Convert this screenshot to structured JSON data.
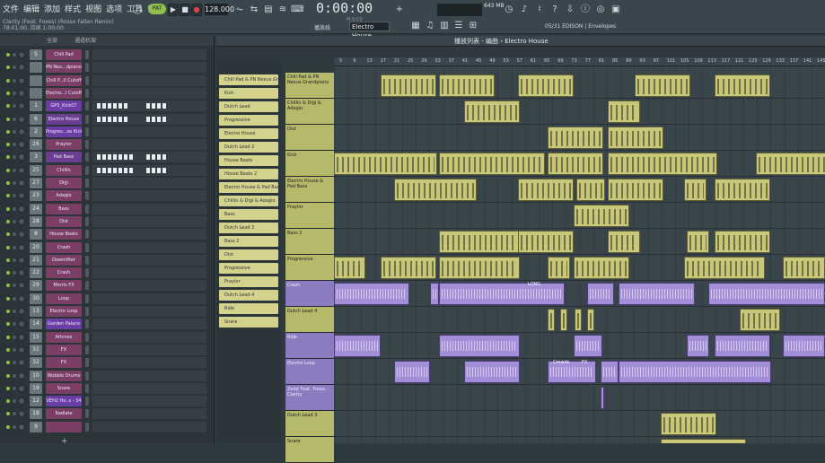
{
  "menu": [
    "文件",
    "编辑",
    "添加",
    "样式",
    "视图",
    "选项",
    "工具",
    "帮助"
  ],
  "song": {
    "title": "Clarity (Feat. Foxes) (Rosso Fallen Remix)",
    "info": "78:01:00, 持续 1:00:00"
  },
  "transport": {
    "pat": "PAT",
    "tempo": "128.000",
    "time": "0:00:00",
    "time_sub": "M:S:CS",
    "playback": "播放线",
    "pattern": "Electro House"
  },
  "memory": "643 MB",
  "hint": "05/31  EDISON | Envelopes",
  "rack": {
    "header": "全部",
    "title": "通道机架",
    "footer": "+",
    "channels": [
      {
        "num": "5",
        "name": "Chill Pad",
        "color": "#7b3e64"
      },
      {
        "num": "",
        "name": "PN Nex...dpiano",
        "color": "#7b3e64"
      },
      {
        "num": "",
        "name": "Chill P...il Cutoff",
        "color": "#7b3e64"
      },
      {
        "num": "",
        "name": "Electro...l Cutoff",
        "color": "#7b3e64"
      },
      {
        "num": "1",
        "name": "GPS_Kick07",
        "color": "#6a3ea4"
      },
      {
        "num": "6",
        "name": "Electro House",
        "color": "#6a3e90"
      },
      {
        "num": "2",
        "name": "Progres...se Kick",
        "color": "#6a3ea4"
      },
      {
        "num": "26",
        "name": "Praylor",
        "color": "#7b3e64"
      },
      {
        "num": "3",
        "name": "Pad Bass",
        "color": "#6a3e90"
      },
      {
        "num": "25",
        "name": "Chillin",
        "color": "#7b3e64"
      },
      {
        "num": "27",
        "name": "Digi",
        "color": "#7b3e64"
      },
      {
        "num": "23",
        "name": "Adagio",
        "color": "#7b3e64"
      },
      {
        "num": "24",
        "name": "Bass",
        "color": "#7b3e64"
      },
      {
        "num": "28",
        "name": "Dist",
        "color": "#7b3e64"
      },
      {
        "num": "8",
        "name": "House Beats",
        "color": "#7b3e64"
      },
      {
        "num": "20",
        "name": "Crash",
        "color": "#7b3e64"
      },
      {
        "num": "21",
        "name": "Downlifter",
        "color": "#7b3e64"
      },
      {
        "num": "22",
        "name": "Crash",
        "color": "#7b3e64"
      },
      {
        "num": "29",
        "name": "Morris FX",
        "color": "#7b3e64"
      },
      {
        "num": "30",
        "name": "Loop",
        "color": "#7b3e64"
      },
      {
        "num": "13",
        "name": "Electro Loop",
        "color": "#7b3e64"
      },
      {
        "num": "14",
        "name": "Garden Palace",
        "color": "#6a3ea4"
      },
      {
        "num": "15",
        "name": "Athmos",
        "color": "#7b3e64"
      },
      {
        "num": "31",
        "name": "FX",
        "color": "#7b3e64"
      },
      {
        "num": "32",
        "name": "FX",
        "color": "#7b3e64"
      },
      {
        "num": "10",
        "name": "Wobble Drums",
        "color": "#7b3e64"
      },
      {
        "num": "19",
        "name": "Snare",
        "color": "#7b3e64"
      },
      {
        "num": "12",
        "name": "VEH2 Ho..s - 34",
        "color": "#6a3ea4"
      },
      {
        "num": "18",
        "name": "Radiate",
        "color": "#7b3e64"
      },
      {
        "num": "9",
        "name": "",
        "color": "#7b3e64"
      }
    ]
  },
  "picker": [
    "Chill Pad & PN Nexus Grandpiano",
    "Kick",
    "Dutch Lead",
    "Progressive",
    "Electro House",
    "Dutch Lead 2",
    "House Beats",
    "House Beats 2",
    "Electro House & Pad Bass",
    "Chillin & Digi & Adagio",
    "Bass",
    "Dutch Lead 3",
    "Bass 2",
    "Dist",
    "Progressive",
    "Praylor",
    "Dutch Lead 4",
    "Ride",
    "Snare"
  ],
  "playlist": {
    "title": "播放列表 - 编曲 › Electro House",
    "ruler": [
      "5",
      "9",
      "13",
      "17",
      "21",
      "25",
      "29",
      "33",
      "37",
      "41",
      "45",
      "49",
      "53",
      "57",
      "61",
      "65",
      "69",
      "73",
      "77",
      "81",
      "85",
      "89",
      "93",
      "97",
      "101",
      "105",
      "109",
      "113",
      "117",
      "121",
      "125",
      "129",
      "133",
      "137",
      "141",
      "145"
    ],
    "tracks": [
      {
        "name": "Chill Pad & PN Nexus Grandpiano",
        "type": "p"
      },
      {
        "name": "Chillin & Digi & Adagio",
        "type": "p"
      },
      {
        "name": "Dist",
        "type": "p"
      },
      {
        "name": "Kick",
        "type": "p"
      },
      {
        "name": "Electro House & Pad Bass",
        "type": "p"
      },
      {
        "name": "Praylor",
        "type": "p"
      },
      {
        "name": "Bass 2",
        "type": "p"
      },
      {
        "name": "Progressive",
        "type": "p"
      },
      {
        "name": "Crash",
        "type": "a"
      },
      {
        "name": "Dutch Lead 4",
        "type": "p"
      },
      {
        "name": "Ride",
        "type": "a"
      },
      {
        "name": "Electro Loop",
        "type": "a"
      },
      {
        "name": "Zedd Feat. Foxes - Clarity",
        "type": "a"
      },
      {
        "name": "Dutch Lead 3",
        "type": "p"
      },
      {
        "name": "Snare",
        "type": "p"
      }
    ],
    "clip_labels": {
      "long": "LONG",
      "crowds": "Crowds",
      "fx": "FX"
    }
  }
}
